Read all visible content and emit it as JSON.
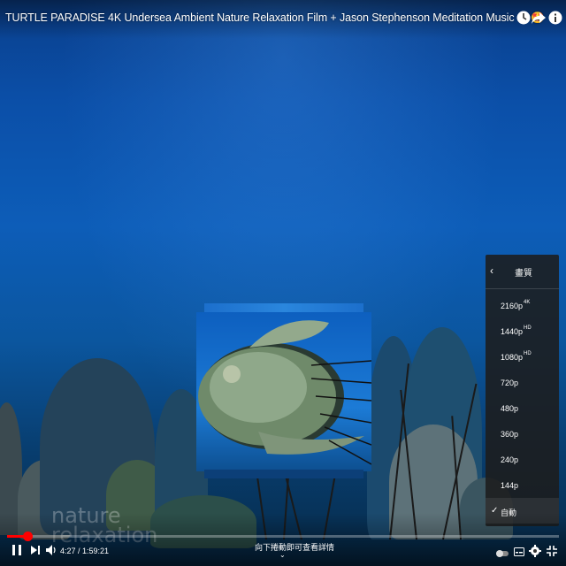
{
  "video": {
    "title": "TURTLE PARADISE 4K Undersea Ambient Nature Relaxation Film + Jason Stephenson Meditation Music 🐢🤩"
  },
  "watermark": {
    "line1": "nature",
    "line2": "relaxation"
  },
  "quality_menu": {
    "back_icon": "chevron-left-icon",
    "title": "畫質",
    "items": [
      {
        "label": "2160p",
        "badge": "4K"
      },
      {
        "label": "1440p",
        "badge": "HD"
      },
      {
        "label": "1080p",
        "badge": "HD"
      },
      {
        "label": "720p",
        "badge": ""
      },
      {
        "label": "480p",
        "badge": ""
      },
      {
        "label": "360p",
        "badge": ""
      },
      {
        "label": "240p",
        "badge": ""
      },
      {
        "label": "144p",
        "badge": ""
      },
      {
        "label": "自動",
        "badge": "",
        "selected": true
      }
    ],
    "check_mark": "✓"
  },
  "controls": {
    "time": "4:27 / 1:59:21",
    "progress_fraction": 0.037,
    "scroll_hint": "向下捲動即可查看詳情",
    "scroll_chevron": "⌄"
  },
  "colors": {
    "progress": "#ff0000",
    "menu_bg": "#1c1c1c"
  }
}
